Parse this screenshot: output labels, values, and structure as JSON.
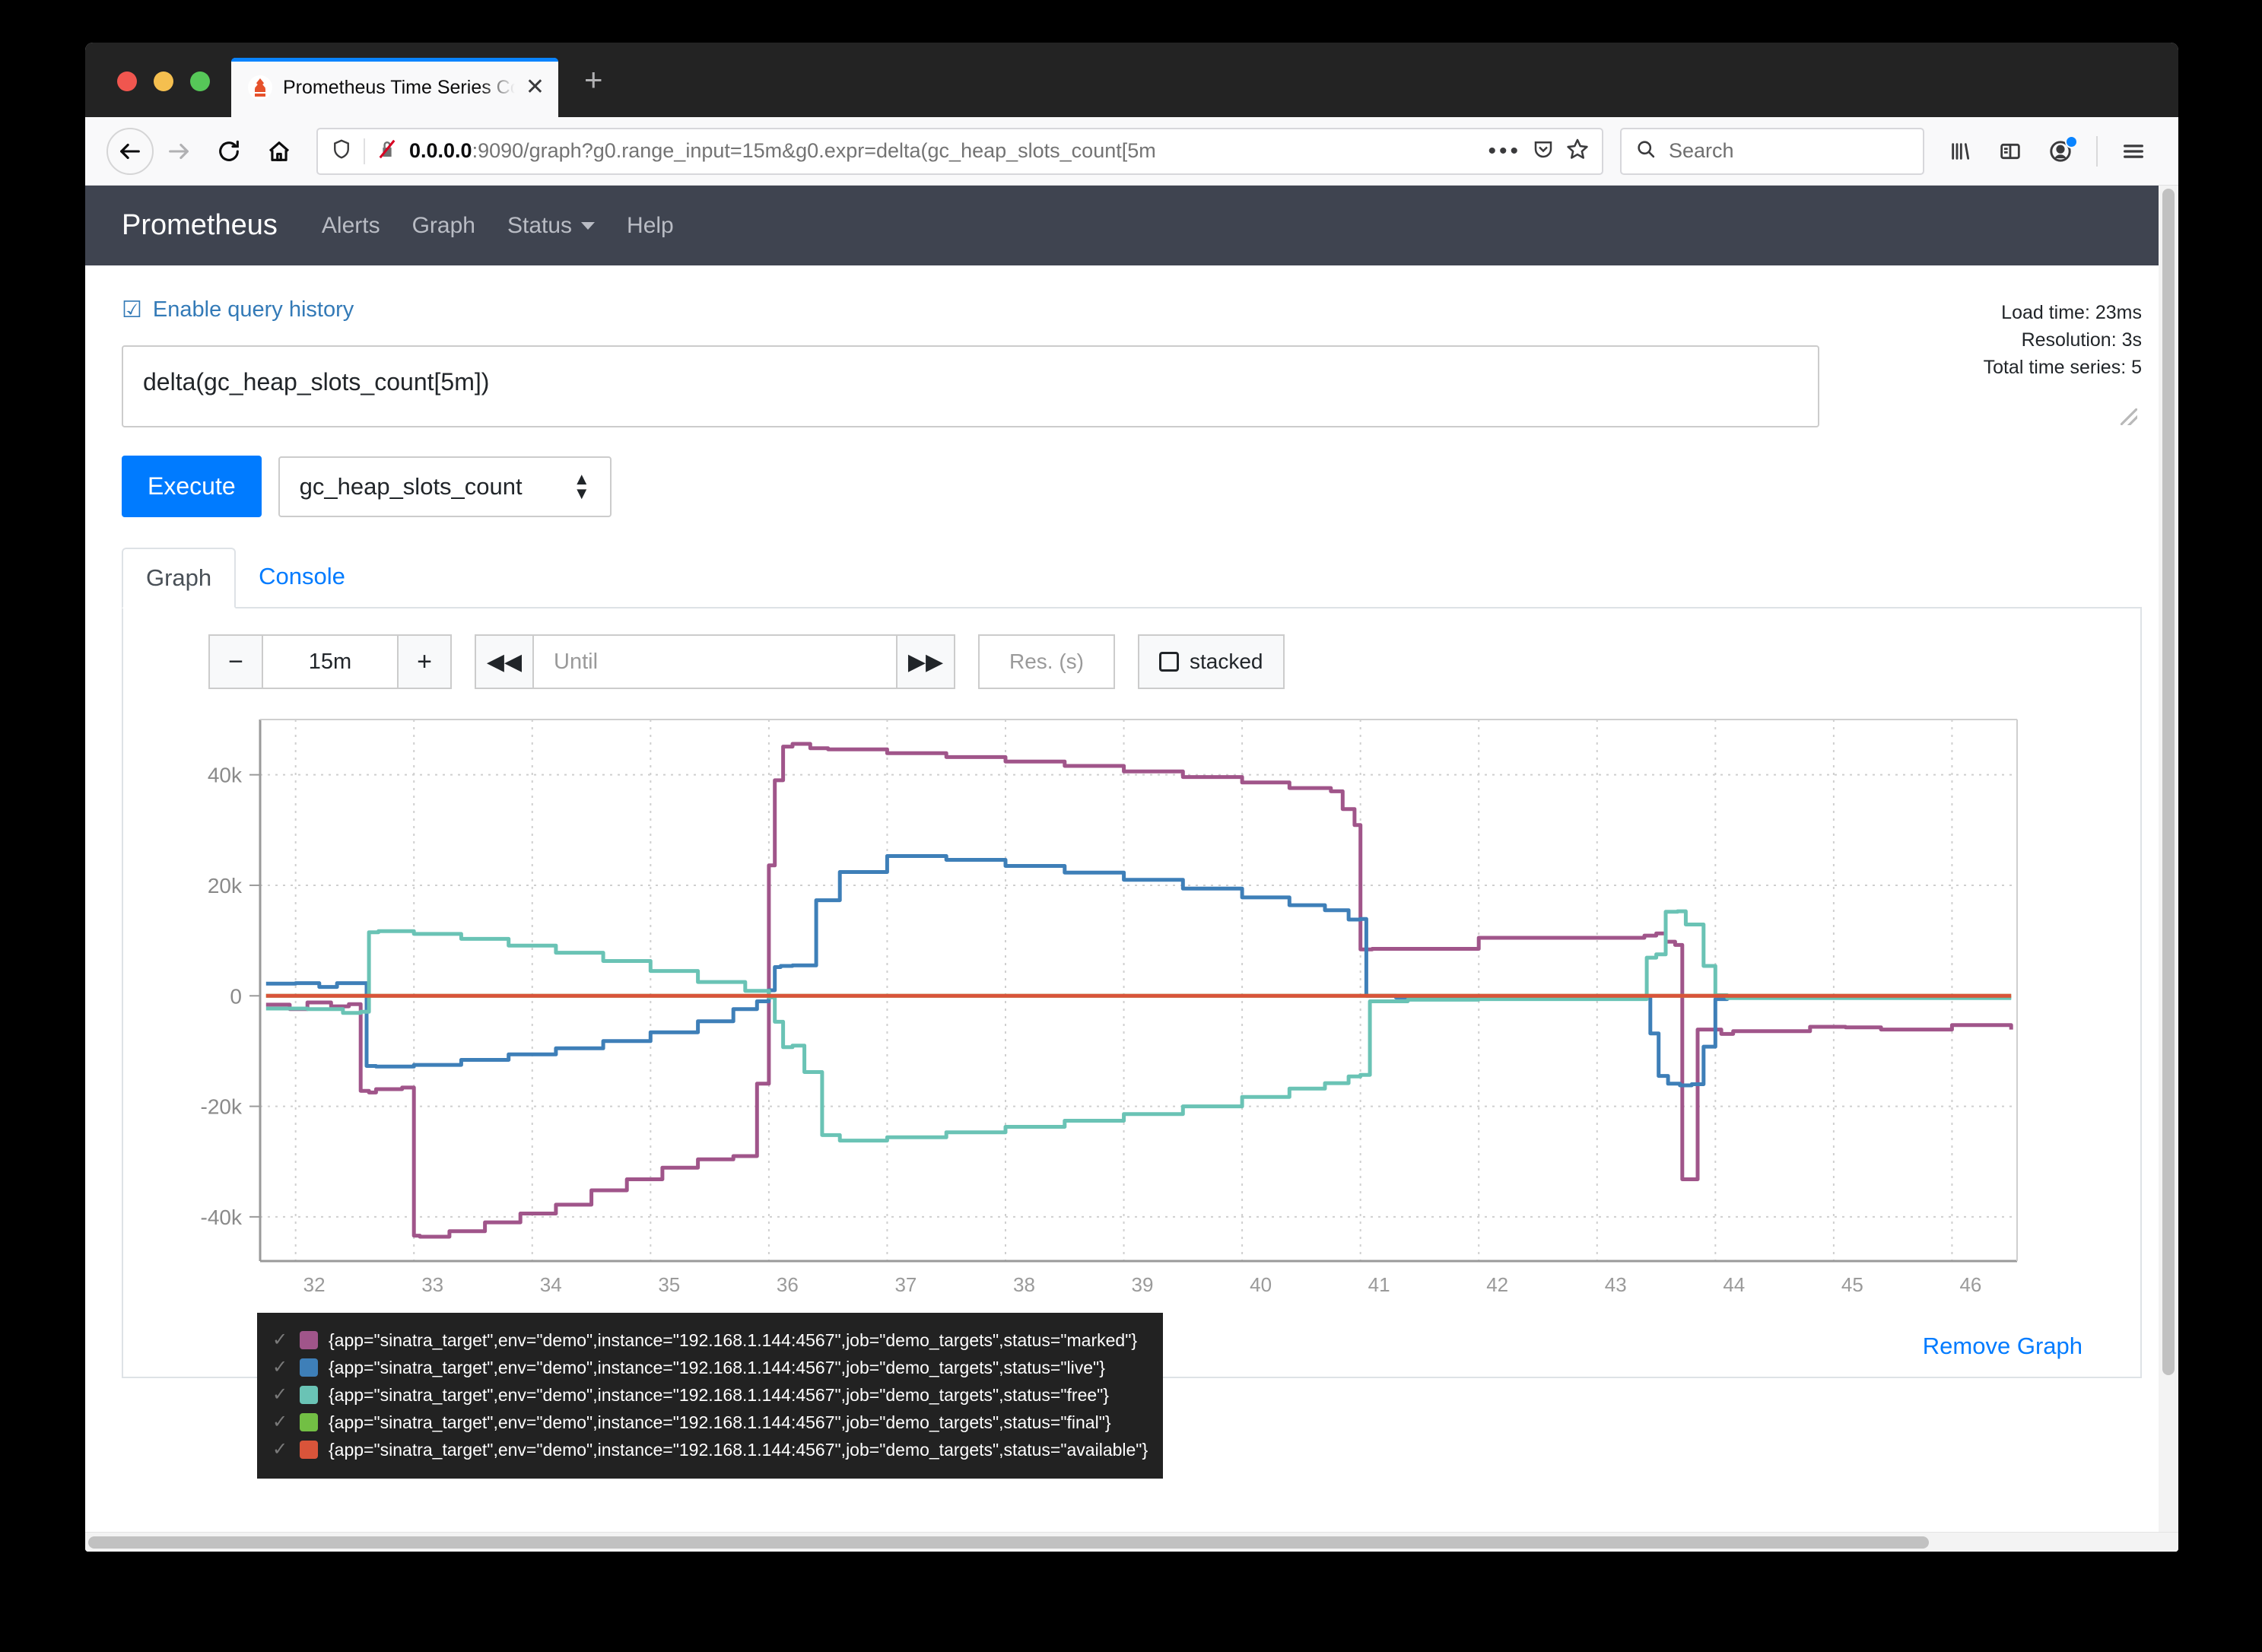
{
  "browser": {
    "tab_title": "Prometheus Time Series Collec",
    "tab_close": "✕",
    "new_tab": "+",
    "url_host": "0.0.0.0",
    "url_rest": ":9090/graph?g0.range_input=15m&g0.expr=delta(gc_heap_slots_count[5m",
    "search_placeholder": "Search",
    "icons": {
      "back": "back-arrow-icon",
      "forward": "forward-arrow-icon",
      "reload": "reload-icon",
      "home": "home-icon",
      "shield": "shield-icon",
      "no-https": "broken-lock-icon",
      "page-actions": "ellipsis-icon",
      "pocket": "pocket-icon",
      "bookmark": "star-icon",
      "library": "library-icon",
      "sidebar": "sidebar-icon",
      "account": "account-icon",
      "menu": "hamburger-menu-icon"
    }
  },
  "prometheus": {
    "brand": "Prometheus",
    "nav": [
      {
        "label": "Alerts"
      },
      {
        "label": "Graph"
      },
      {
        "label": "Status",
        "caret": true
      },
      {
        "label": "Help"
      }
    ],
    "query_history": {
      "label": "Enable query history",
      "checked_glyph": "☑"
    },
    "expression": "delta(gc_heap_slots_count[5m])",
    "stats": {
      "load_time": "Load time: 23ms",
      "resolution": "Resolution: 3s",
      "total_series": "Total time series: 5"
    },
    "execute_label": "Execute",
    "metric_selected": "gc_heap_slots_count",
    "tabs": [
      {
        "label": "Graph",
        "active": true
      },
      {
        "label": "Console",
        "active": false
      }
    ],
    "controls": {
      "minus": "−",
      "range": "15m",
      "plus": "+",
      "rewind": "◀◀",
      "until_placeholder": "Until",
      "forward": "▶▶",
      "res_placeholder": "Res. (s)",
      "stacked_label": "stacked"
    },
    "remove_graph": "Remove Graph"
  },
  "chart_data": {
    "type": "line",
    "title": "",
    "xlabel": "",
    "ylabel": "",
    "xlim": [
      31.7,
      46.55
    ],
    "ylim": [
      -48000,
      50000
    ],
    "xticks": [
      32,
      33,
      34,
      35,
      36,
      37,
      38,
      39,
      40,
      41,
      42,
      43,
      44,
      45,
      46
    ],
    "yticks": [
      -40000,
      -20000,
      0,
      20000,
      40000
    ],
    "ytick_labels": [
      "-40k",
      "-20k",
      "0",
      "20k",
      "40k"
    ],
    "grid": true,
    "legend_position": "below-left",
    "colors": {
      "marked": "#a0558a",
      "live": "#3e7fb8",
      "free": "#6ac3b5",
      "final": "#72bf44",
      "available": "#d9543a"
    },
    "series": [
      {
        "name": "marked",
        "label": "{app=\"sinatra_target\",env=\"demo\",instance=\"192.168.1.144:4567\",job=\"demo_targets\",status=\"marked\"}",
        "color": "#a0558a",
        "enabled": true,
        "x": [
          31.75,
          31.95,
          32.1,
          32.3,
          32.45,
          32.55,
          32.62,
          32.68,
          32.9,
          33.0,
          33.05,
          33.3,
          33.6,
          33.9,
          34.2,
          34.5,
          34.8,
          35.1,
          35.4,
          35.7,
          35.9,
          36.0,
          36.05,
          36.12,
          36.2,
          36.35,
          36.5,
          37.0,
          37.5,
          38.0,
          38.5,
          39.0,
          39.5,
          40.0,
          40.4,
          40.75,
          40.85,
          40.95,
          41.0,
          41.1,
          41.5,
          42.0,
          42.3,
          42.6,
          43.0,
          43.4,
          43.5,
          43.58,
          43.66,
          43.72,
          43.78,
          43.85,
          43.95,
          44.05,
          44.15,
          44.4,
          44.8,
          45.1,
          45.4,
          45.7,
          46.0,
          46.3,
          46.5
        ],
        "y": [
          -1600,
          -2400,
          -1200,
          -1900,
          -1500,
          -17200,
          -17500,
          -16900,
          -16600,
          -43400,
          -43600,
          -42600,
          -41000,
          -39400,
          -37800,
          -35200,
          -33200,
          -31100,
          -29600,
          -29000,
          -15900,
          23600,
          39000,
          45100,
          45600,
          44800,
          44600,
          43900,
          43200,
          42400,
          41600,
          40600,
          39600,
          38600,
          37600,
          37000,
          33800,
          30900,
          8400,
          8500,
          8500,
          10500,
          10500,
          10500,
          10500,
          10900,
          11300,
          9800,
          9200,
          -33200,
          -33200,
          -6100,
          -6100,
          -6900,
          -6400,
          -6400,
          -5600,
          -5700,
          -6100,
          -6100,
          -5300,
          -5300,
          -6100
        ]
      },
      {
        "name": "live",
        "label": "{app=\"sinatra_target\",env=\"demo\",instance=\"192.168.1.144:4567\",job=\"demo_targets\",status=\"live\"}",
        "color": "#3e7fb8",
        "enabled": true,
        "x": [
          31.75,
          32.0,
          32.2,
          32.35,
          32.5,
          32.6,
          32.68,
          33.0,
          33.4,
          33.8,
          34.2,
          34.6,
          35.0,
          35.4,
          35.7,
          35.9,
          36.0,
          36.05,
          36.1,
          36.2,
          36.4,
          36.6,
          37.0,
          37.5,
          38.0,
          38.5,
          39.0,
          39.5,
          40.0,
          40.4,
          40.7,
          40.9,
          41.0,
          41.05,
          41.3,
          42.0,
          42.6,
          43.2,
          43.45,
          43.52,
          43.6,
          43.7,
          43.8,
          43.9,
          44.0,
          44.1,
          44.3,
          44.8,
          45.4,
          46.0,
          46.5
        ],
        "y": [
          2200,
          2300,
          1600,
          2300,
          2300,
          -12700,
          -12800,
          -12500,
          -11600,
          -10600,
          -9500,
          -8200,
          -6600,
          -4600,
          -2400,
          -1000,
          1000,
          5200,
          5400,
          5500,
          17300,
          22400,
          25300,
          24600,
          23500,
          22300,
          21000,
          19400,
          17800,
          16400,
          15500,
          13800,
          13900,
          0,
          -300,
          -300,
          -300,
          -300,
          -6800,
          -14500,
          -15900,
          -16200,
          -16000,
          -9200,
          -600,
          -300,
          -300,
          -300,
          -300,
          -300,
          -300
        ]
      },
      {
        "name": "free",
        "label": "{app=\"sinatra_target\",env=\"demo\",instance=\"192.168.1.144:4567\",job=\"demo_targets\",status=\"free\"}",
        "color": "#6ac3b5",
        "enabled": true,
        "x": [
          31.75,
          32.1,
          32.4,
          32.55,
          32.62,
          32.7,
          33.0,
          33.4,
          33.8,
          34.2,
          34.6,
          35.0,
          35.4,
          35.8,
          36.0,
          36.05,
          36.12,
          36.2,
          36.3,
          36.45,
          36.6,
          37.0,
          37.5,
          38.0,
          38.5,
          39.0,
          39.5,
          40.0,
          40.4,
          40.7,
          40.9,
          41.0,
          41.08,
          41.4,
          42.0,
          42.6,
          43.2,
          43.42,
          43.5,
          43.58,
          43.68,
          43.75,
          43.82,
          43.9,
          44.0,
          44.1,
          44.4,
          45.0,
          45.6,
          46.1,
          46.5
        ],
        "y": [
          -2300,
          -2400,
          -3100,
          -2900,
          11500,
          11700,
          11200,
          10300,
          9100,
          7800,
          6300,
          4500,
          2500,
          900,
          -300,
          -4700,
          -9300,
          -9000,
          -13800,
          -25200,
          -26200,
          -25600,
          -24700,
          -23700,
          -22600,
          -21400,
          -20000,
          -18300,
          -16800,
          -15800,
          -14600,
          -14300,
          -1000,
          -700,
          -600,
          -600,
          -600,
          6900,
          7500,
          15200,
          15300,
          12900,
          12900,
          5400,
          100,
          -400,
          -400,
          -400,
          -400,
          -400,
          -400
        ]
      },
      {
        "name": "final",
        "label": "{app=\"sinatra_target\",env=\"demo\",instance=\"192.168.1.144:4567\",job=\"demo_targets\",status=\"final\"}",
        "color": "#72bf44",
        "enabled": true,
        "x": [
          31.75,
          46.5
        ],
        "y": [
          0,
          0
        ]
      },
      {
        "name": "available",
        "label": "{app=\"sinatra_target\",env=\"demo\",instance=\"192.168.1.144:4567\",job=\"demo_targets\",status=\"available\"}",
        "color": "#d9543a",
        "enabled": true,
        "x": [
          31.75,
          46.5
        ],
        "y": [
          0,
          0
        ]
      }
    ]
  }
}
